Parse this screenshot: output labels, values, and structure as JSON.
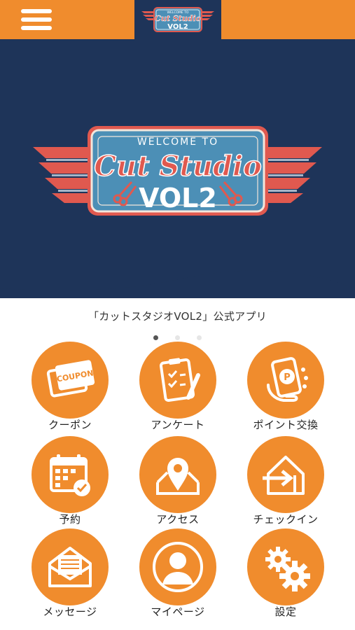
{
  "header": {
    "menu_icon": "hamburger-menu-icon",
    "logo": {
      "line1": "WELCOME TO",
      "line2": "Cut Studio",
      "line3": "VOL2"
    }
  },
  "hero": {
    "logo": {
      "line1": "WELCOME TO",
      "line2": "Cut Studio",
      "line3": "VOL2"
    }
  },
  "tagline": "「カットスタジオVOL2」公式アプリ",
  "carousel": {
    "count": 3,
    "active": 0
  },
  "menu": [
    {
      "label": "クーポン",
      "icon": "coupon-icon",
      "coupon_text": "COUPON"
    },
    {
      "label": "アンケート",
      "icon": "survey-clipboard-icon"
    },
    {
      "label": "ポイント交換",
      "icon": "point-exchange-icon",
      "point_text": "P"
    },
    {
      "label": "予約",
      "icon": "reservation-calendar-icon"
    },
    {
      "label": "アクセス",
      "icon": "map-pin-icon"
    },
    {
      "label": "チェックイン",
      "icon": "check-in-icon"
    },
    {
      "label": "メッセージ",
      "icon": "message-envelope-icon"
    },
    {
      "label": "マイページ",
      "icon": "my-page-user-icon"
    },
    {
      "label": "設定",
      "icon": "settings-gears-icon"
    }
  ],
  "colors": {
    "orange": "#f08c2d",
    "navy": "#1e3459",
    "sign_blue": "#4c8fb6",
    "sign_red": "#e0594f"
  }
}
